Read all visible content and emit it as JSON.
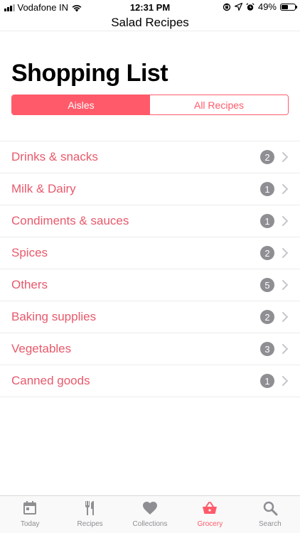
{
  "status_bar": {
    "carrier": "Vodafone IN",
    "time": "12:31 PM",
    "battery": "49%",
    "battery_level": 0.49
  },
  "nav": {
    "title": "Salad Recipes"
  },
  "page": {
    "title": "Shopping List"
  },
  "segments": [
    {
      "label": "Aisles",
      "active": true
    },
    {
      "label": "All Recipes",
      "active": false
    }
  ],
  "aisles": [
    {
      "label": "Drinks & snacks",
      "count": "2"
    },
    {
      "label": "Milk & Dairy",
      "count": "1"
    },
    {
      "label": "Condiments & sauces",
      "count": "1"
    },
    {
      "label": "Spices",
      "count": "2"
    },
    {
      "label": "Others",
      "count": "5"
    },
    {
      "label": "Baking supplies",
      "count": "2"
    },
    {
      "label": "Vegetables",
      "count": "3"
    },
    {
      "label": "Canned goods",
      "count": "1"
    }
  ],
  "tabs": [
    {
      "label": "Today",
      "icon": "calendar-icon",
      "active": false
    },
    {
      "label": "Recipes",
      "icon": "fork-knife-icon",
      "active": false
    },
    {
      "label": "Collections",
      "icon": "heart-icon",
      "active": false
    },
    {
      "label": "Grocery",
      "icon": "basket-icon",
      "active": true
    },
    {
      "label": "Search",
      "icon": "magnifier-icon",
      "active": false
    }
  ],
  "colors": {
    "accent": "#ff5a6a",
    "list_text": "#e8596b",
    "badge": "#8e8e93",
    "tab_inactive": "#8e8e93"
  }
}
